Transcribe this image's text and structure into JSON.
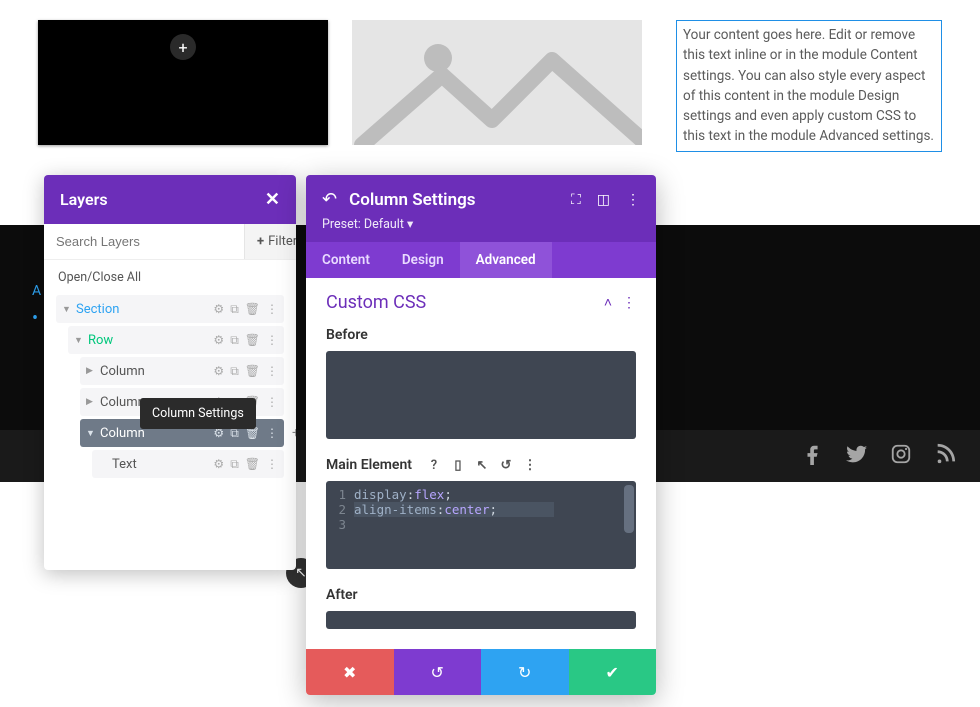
{
  "preview": {
    "placeholder_text": "Your content goes here. Edit or remove this text inline or in the module Content settings. You can also style every aspect of this content in the module Design settings and even apply custom CSS to this text in the module Advanced settings."
  },
  "layers": {
    "title": "Layers",
    "search_placeholder": "Search Layers",
    "filter_label": "Filter",
    "openclose": "Open/Close All",
    "tree": {
      "section": "Section",
      "row": "Row",
      "column1": "Column",
      "column2": "Column",
      "column3": "Column",
      "text": "Text"
    }
  },
  "tooltip": "Column Settings",
  "settings": {
    "title": "Column Settings",
    "preset": "Preset: Default",
    "tabs": {
      "content": "Content",
      "design": "Design",
      "advanced": "Advanced"
    },
    "section_title": "Custom CSS",
    "fields": {
      "before": "Before",
      "main": "Main Element",
      "after": "After"
    },
    "code": {
      "line1_prop": "display",
      "line1_val": "flex",
      "line2_prop": "align-items",
      "line2_val": "center"
    }
  },
  "colors": {
    "purple": "#6c2eb9",
    "blue": "#2ea3f2",
    "green": "#29c885",
    "red": "#e55b5b"
  }
}
